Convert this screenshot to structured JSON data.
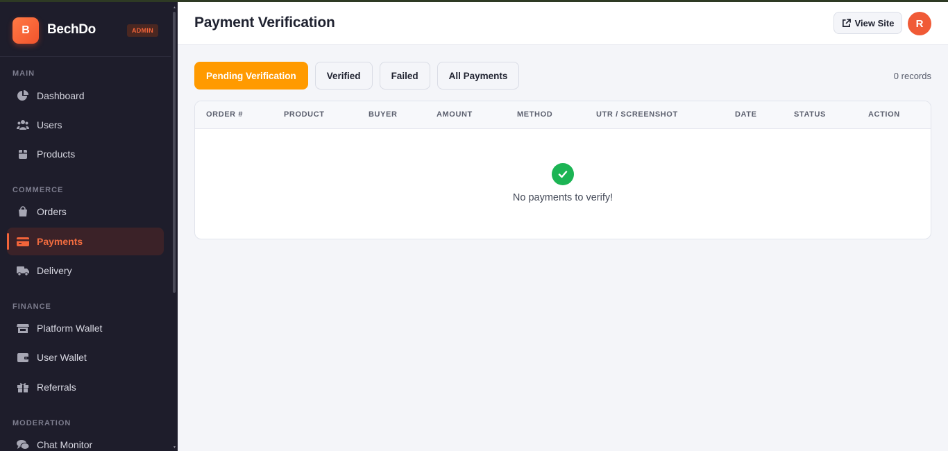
{
  "sidebar": {
    "brand": {
      "logo_letter": "B",
      "name": "BechDo",
      "badge": "ADMIN"
    },
    "sections": [
      {
        "label": "MAIN",
        "items": [
          {
            "label": "Dashboard",
            "icon": "pie-chart-icon"
          },
          {
            "label": "Users",
            "icon": "users-icon"
          },
          {
            "label": "Products",
            "icon": "box-icon"
          }
        ]
      },
      {
        "label": "COMMERCE",
        "items": [
          {
            "label": "Orders",
            "icon": "shopping-bag-icon"
          },
          {
            "label": "Payments",
            "icon": "credit-card-icon",
            "active": true
          },
          {
            "label": "Delivery",
            "icon": "truck-icon"
          }
        ]
      },
      {
        "label": "FINANCE",
        "items": [
          {
            "label": "Platform Wallet",
            "icon": "store-icon"
          },
          {
            "label": "User Wallet",
            "icon": "wallet-icon"
          },
          {
            "label": "Referrals",
            "icon": "gift-icon"
          }
        ]
      },
      {
        "label": "MODERATION",
        "items": [
          {
            "label": "Chat Monitor",
            "icon": "chat-icon"
          }
        ]
      }
    ]
  },
  "header": {
    "title": "Payment Verification",
    "view_site": "View Site",
    "avatar_initial": "R"
  },
  "filters": {
    "tabs": [
      {
        "label": "Pending Verification",
        "active": true
      },
      {
        "label": "Verified"
      },
      {
        "label": "Failed"
      },
      {
        "label": "All Payments"
      }
    ],
    "record_count": "0 records"
  },
  "table": {
    "columns": [
      "ORDER #",
      "PRODUCT",
      "BUYER",
      "AMOUNT",
      "METHOD",
      "UTR / SCREENSHOT",
      "DATE",
      "STATUS",
      "ACTION"
    ],
    "rows": [],
    "empty_message": "No payments to verify!"
  },
  "colors": {
    "accent": "#f2643a",
    "tab_active": "#ff9a00",
    "success": "#1cb454",
    "sidebar_bg": "#1e1d2b"
  }
}
